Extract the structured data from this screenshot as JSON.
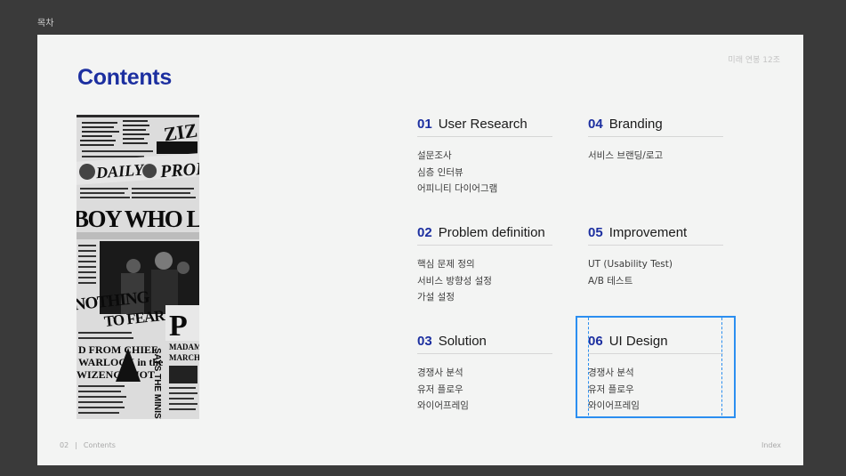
{
  "frame": {
    "label": "목차"
  },
  "slide": {
    "team": "미래 연봉 12조",
    "title": "Contents",
    "image": {
      "description": "newspaper-collage",
      "headlines": [
        "DAILY",
        "PROPHET",
        "BOY WHO LIVES",
        "NOTHING TO FEAR",
        "FROM CHIEF",
        "WARLOCK in the",
        "WIZENGAMOT",
        "SAYS THE MINISTER",
        "MADAM",
        "MARCHBANKS"
      ]
    },
    "sections": [
      {
        "num": "01",
        "label": "User Research",
        "items": [
          "설문조사",
          "심층 인터뷰",
          "어피니티 다이어그램"
        ]
      },
      {
        "num": "04",
        "label": "Branding",
        "items": [
          "서비스 브랜딩/로고"
        ]
      },
      {
        "num": "02",
        "label": "Problem definition",
        "items": [
          "핵심 문제 정의",
          "서비스 방향성 설정",
          "가설 설정"
        ]
      },
      {
        "num": "05",
        "label": "Improvement",
        "items": [
          "UT (Usability Test)",
          "A/B 테스트"
        ]
      },
      {
        "num": "03",
        "label": "Solution",
        "items": [
          "경쟁사 분석",
          "유저 플로우",
          "와이어프레임"
        ]
      },
      {
        "num": "06",
        "label": "UI Design",
        "items": [
          "경쟁사 분석",
          "유저 플로우",
          "와이어프레임"
        ]
      }
    ],
    "footer": {
      "page": "02",
      "separator": "|",
      "section": "Contents",
      "right": "Index"
    }
  },
  "colors": {
    "accent": "#1c2fa0",
    "selection": "#2b8ef0",
    "slide_bg": "#f3f4f3",
    "canvas_bg": "#3a3a3a"
  }
}
